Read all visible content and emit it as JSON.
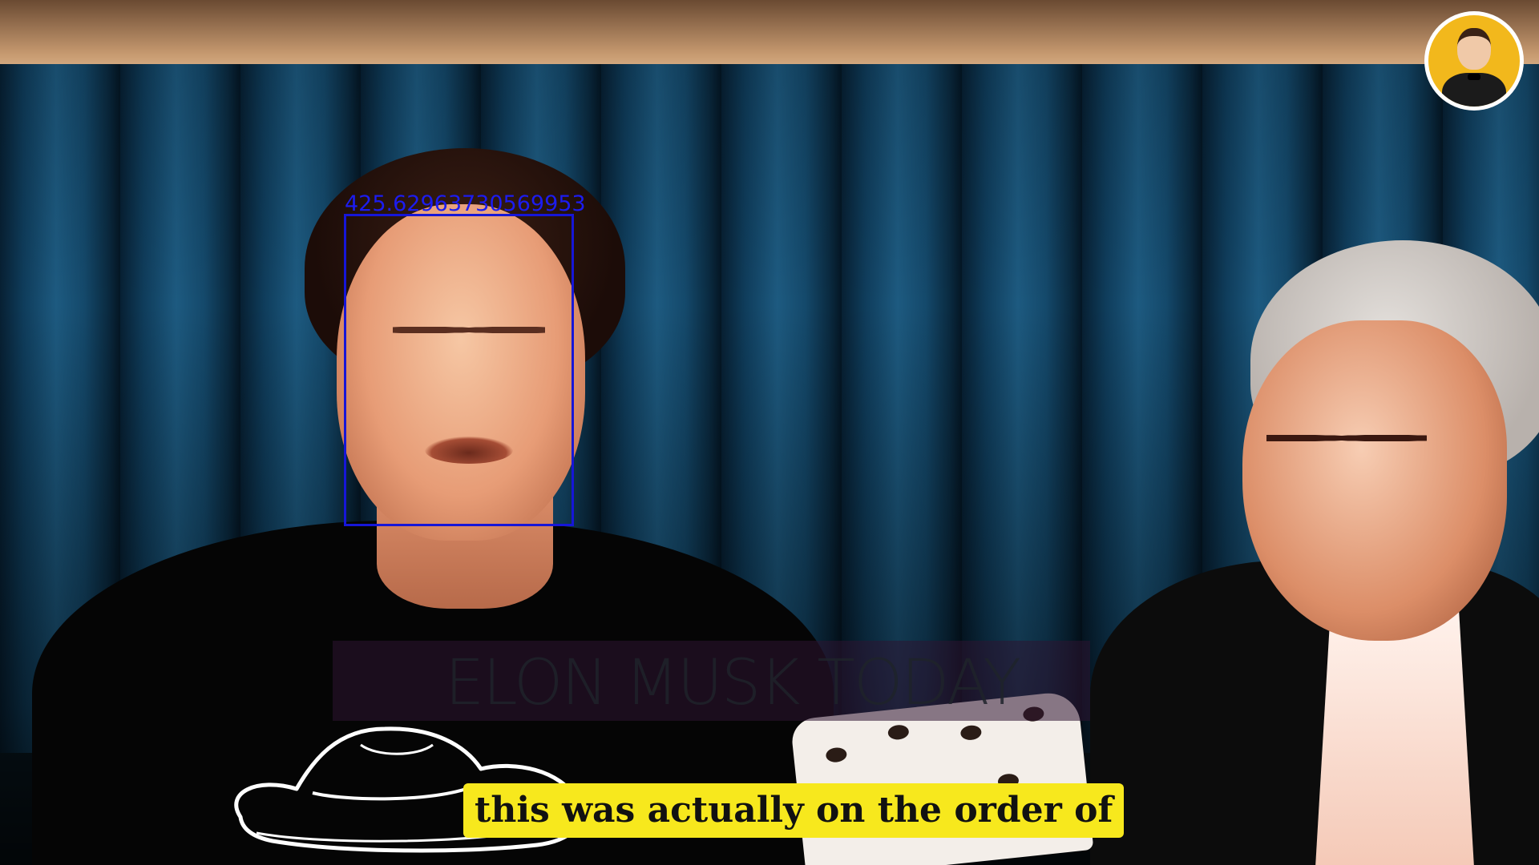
{
  "video": {
    "detection_label": "425.62963730569953",
    "watermark": "ELON MUSK TODAY",
    "caption": "this was actually on the order of"
  },
  "colors": {
    "caption_background": "#f7e81d",
    "detection_box": "#1616d8",
    "avatar_background": "#f2b81c"
  },
  "icons": {
    "channel_avatar": "channel-avatar-icon",
    "hat": "cowboy-hat-icon"
  }
}
